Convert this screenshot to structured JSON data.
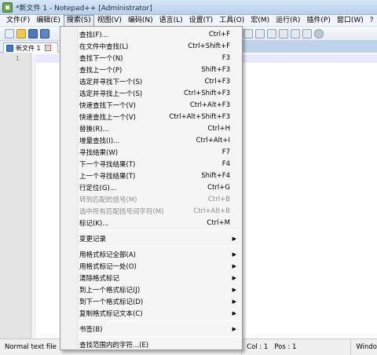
{
  "window": {
    "title": "*新文件 1 - Notepad++ [Administrator]"
  },
  "menubar": {
    "items": [
      "文件(F)",
      "编辑(E)",
      "搜索(S)",
      "视图(V)",
      "编码(N)",
      "语言(L)",
      "设置(T)",
      "工具(O)",
      "宏(M)",
      "运行(R)",
      "插件(P)",
      "窗口(W)",
      "?"
    ],
    "active": "搜索(S)"
  },
  "tab": {
    "label": "新文件 1"
  },
  "editor": {
    "line_numbers": [
      "1"
    ]
  },
  "status": {
    "file_type": "Normal text file",
    "col": "Col : 1",
    "pos": "Pos : 1",
    "eol": "Windo"
  },
  "search_menu": {
    "items": [
      {
        "label": "查找(F)...",
        "shortcut": "Ctrl+F"
      },
      {
        "label": "在文件中查找(L)",
        "shortcut": "Ctrl+Shift+F"
      },
      {
        "label": "查找下一个(N)",
        "shortcut": "F3"
      },
      {
        "label": "查找上一个(P)",
        "shortcut": "Shift+F3"
      },
      {
        "label": "选定并寻找下一个(S)",
        "shortcut": "Ctrl+F3"
      },
      {
        "label": "选定并寻找上一个(S)",
        "shortcut": "Ctrl+Shift+F3"
      },
      {
        "label": "快速查找下一个(V)",
        "shortcut": "Ctrl+Alt+F3"
      },
      {
        "label": "快速查找上一个(V)",
        "shortcut": "Ctrl+Alt+Shift+F3"
      },
      {
        "label": "替换(R)...",
        "shortcut": "Ctrl+H"
      },
      {
        "label": "增量查找(I)...",
        "shortcut": "Ctrl+Alt+I"
      },
      {
        "label": "寻找结果(W)",
        "shortcut": "F7"
      },
      {
        "label": "下一个寻找结果(T)",
        "shortcut": "F4"
      },
      {
        "label": "上一个寻找结果(T)",
        "shortcut": "Shift+F4"
      },
      {
        "label": "行定位(G)...",
        "shortcut": "Ctrl+G"
      },
      {
        "label": "转到匹配的括号(M)",
        "shortcut": "Ctrl+B",
        "disabled": true
      },
      {
        "label": "选中所有匹配括号间字符(M)",
        "shortcut": "Ctrl+Alt+B",
        "disabled": true
      },
      {
        "label": "标记(K)...",
        "shortcut": "Ctrl+M"
      },
      {
        "label": "变更记录",
        "submenu": true
      },
      {
        "label": "用格式标记全部(A)",
        "submenu": true
      },
      {
        "label": "用格式标记一处(O)",
        "submenu": true
      },
      {
        "label": "清除格式标记",
        "submenu": true
      },
      {
        "label": "到上一个格式标记(J)",
        "submenu": true
      },
      {
        "label": "到下一个格式标记(D)",
        "submenu": true
      },
      {
        "label": "复制格式标记文本(C)",
        "submenu": true
      },
      {
        "label": "书签(B)",
        "submenu": true
      },
      {
        "label": "查找范围内的字符...(E)"
      }
    ]
  }
}
